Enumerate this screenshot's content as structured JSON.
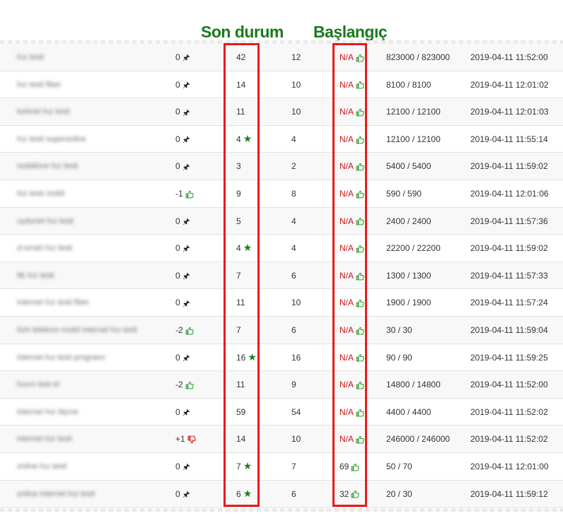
{
  "annotations": {
    "son_durum": "Son durum",
    "baslangic": "Başlangıç"
  },
  "colors": {
    "accent_green": "#1b7a1b",
    "highlight_red": "#e81b1b",
    "na_red": "#d01010",
    "thumb_down_red": "#d01010"
  },
  "rows": [
    {
      "keyword": "hız testi",
      "change": "0",
      "change_icon": "pin-icon",
      "last": "42",
      "last_icon": "",
      "prev": "12",
      "start": "N/A",
      "volume": "823000 / 823000",
      "date": "2019-04-11 11:52:00"
    },
    {
      "keyword": "hız testi fiber",
      "change": "0",
      "change_icon": "pin-icon",
      "last": "14",
      "last_icon": "",
      "prev": "10",
      "start": "N/A",
      "volume": "8100 / 8100",
      "date": "2019-04-11 12:01:02"
    },
    {
      "keyword": "turknet hız testi",
      "change": "0",
      "change_icon": "pin-icon",
      "last": "11",
      "last_icon": "",
      "prev": "10",
      "start": "N/A",
      "volume": "12100 / 12100",
      "date": "2019-04-11 12:01:03"
    },
    {
      "keyword": "hız testi superonline",
      "change": "0",
      "change_icon": "pin-icon",
      "last": "4",
      "last_icon": "star-icon",
      "prev": "4",
      "start": "N/A",
      "volume": "12100 / 12100",
      "date": "2019-04-11 11:55:14"
    },
    {
      "keyword": "vodafone hız testi",
      "change": "0",
      "change_icon": "pin-icon",
      "last": "3",
      "last_icon": "",
      "prev": "2",
      "start": "N/A",
      "volume": "5400 / 5400",
      "date": "2019-04-11 11:59:02"
    },
    {
      "keyword": "hız testi mobil",
      "change": "-1",
      "change_icon": "thumbs-up-icon",
      "last": "9",
      "last_icon": "",
      "prev": "8",
      "start": "N/A",
      "volume": "590 / 590",
      "date": "2019-04-11 12:01:06"
    },
    {
      "keyword": "uydunet hız testi",
      "change": "0",
      "change_icon": "pin-icon",
      "last": "5",
      "last_icon": "",
      "prev": "4",
      "start": "N/A",
      "volume": "2400 / 2400",
      "date": "2019-04-11 11:57:36"
    },
    {
      "keyword": "d-smart hız testi",
      "change": "0",
      "change_icon": "pin-icon",
      "last": "4",
      "last_icon": "star-icon",
      "prev": "4",
      "start": "N/A",
      "volume": "22200 / 22200",
      "date": "2019-04-11 11:59:02"
    },
    {
      "keyword": "ttk hız testi",
      "change": "0",
      "change_icon": "pin-icon",
      "last": "7",
      "last_icon": "",
      "prev": "6",
      "start": "N/A",
      "volume": "1300 / 1300",
      "date": "2019-04-11 11:57:33"
    },
    {
      "keyword": "internet hız testi fiber",
      "change": "0",
      "change_icon": "pin-icon",
      "last": "11",
      "last_icon": "",
      "prev": "10",
      "start": "N/A",
      "volume": "1900 / 1900",
      "date": "2019-04-11 11:57:24"
    },
    {
      "keyword": "türk telekom mobil internet hız testi",
      "change": "-2",
      "change_icon": "thumbs-up-icon",
      "last": "7",
      "last_icon": "",
      "prev": "6",
      "start": "N/A",
      "volume": "30 / 30",
      "date": "2019-04-11 11:59:04"
    },
    {
      "keyword": "internet hız testi programı",
      "change": "0",
      "change_icon": "pin-icon",
      "last": "16",
      "last_icon": "star-icon",
      "prev": "16",
      "start": "N/A",
      "volume": "90 / 90",
      "date": "2019-04-11 11:59:25"
    },
    {
      "keyword": "hızını test et",
      "change": "-2",
      "change_icon": "thumbs-up-icon",
      "last": "11",
      "last_icon": "",
      "prev": "9",
      "start": "N/A",
      "volume": "14800 / 14800",
      "date": "2019-04-11 11:52:00"
    },
    {
      "keyword": "internet hız ölçme",
      "change": "0",
      "change_icon": "pin-icon",
      "last": "59",
      "last_icon": "",
      "prev": "54",
      "start": "N/A",
      "volume": "4400 / 4400",
      "date": "2019-04-11 11:52:02"
    },
    {
      "keyword": "internet hız testi",
      "change": "+1",
      "change_icon": "thumbs-down-icon",
      "last": "14",
      "last_icon": "",
      "prev": "10",
      "start": "N/A",
      "volume": "246000 / 246000",
      "date": "2019-04-11 11:52:02"
    },
    {
      "keyword": "online hız testi",
      "change": "0",
      "change_icon": "pin-icon",
      "last": "7",
      "last_icon": "star-icon",
      "prev": "7",
      "start": "69",
      "volume": "50 / 70",
      "date": "2019-04-11 12:01:00"
    },
    {
      "keyword": "online internet hız testi",
      "change": "0",
      "change_icon": "pin-icon",
      "last": "6",
      "last_icon": "star-icon",
      "prev": "6",
      "start": "32",
      "volume": "20 / 30",
      "date": "2019-04-11 11:59:12"
    }
  ]
}
